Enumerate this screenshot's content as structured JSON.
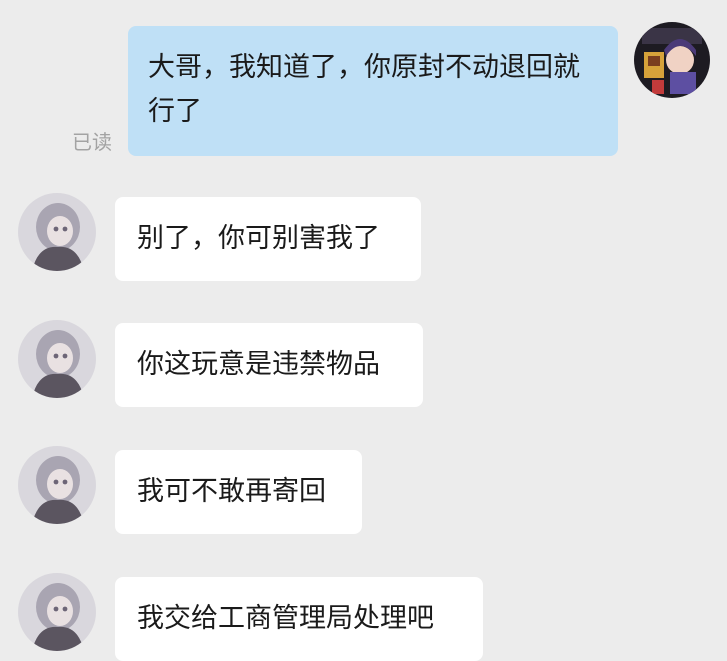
{
  "conversation": {
    "sent": {
      "text": "大哥，我知道了，你原封不动退回就行了",
      "read_status": "已读",
      "avatar_icon": "user-avatar-icon",
      "bubble_color": "#bfe0f6"
    },
    "received": [
      {
        "text": "别了，你可别害我了",
        "avatar_icon": "contact-avatar-icon"
      },
      {
        "text": "你这玩意是违禁物品",
        "avatar_icon": "contact-avatar-icon"
      },
      {
        "text": "我可不敢再寄回",
        "avatar_icon": "contact-avatar-icon"
      },
      {
        "text": "我交给工商管理局处理吧",
        "avatar_icon": "contact-avatar-icon"
      }
    ],
    "received_bubble_color": "#ffffff",
    "background_color": "#ececec"
  }
}
